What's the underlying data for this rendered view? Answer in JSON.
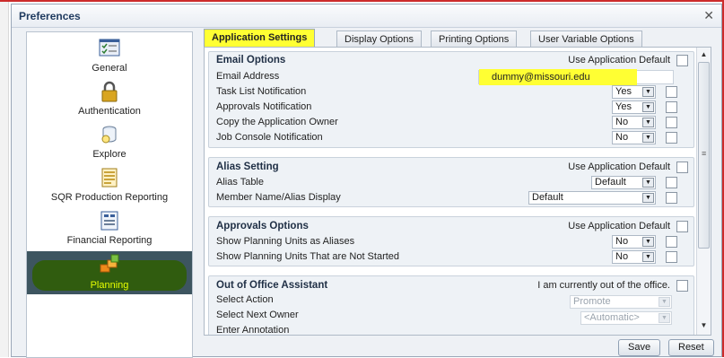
{
  "dialog": {
    "title": "Preferences",
    "close_icon": "close-icon"
  },
  "nav": [
    {
      "label": "General",
      "icon": "general-settings-icon"
    },
    {
      "label": "Authentication",
      "icon": "lock-icon"
    },
    {
      "label": "Explore",
      "icon": "explore-icon"
    },
    {
      "label": "SQR Production Reporting",
      "icon": "sqr-report-icon"
    },
    {
      "label": "Financial Reporting",
      "icon": "financial-report-icon"
    },
    {
      "label": "Planning",
      "icon": "planning-icon",
      "selected": true
    }
  ],
  "tabs": [
    {
      "label": "Application Settings",
      "active": true
    },
    {
      "label": "Display Options"
    },
    {
      "label": "Printing Options"
    },
    {
      "label": "User Variable Options"
    }
  ],
  "email": {
    "title": "Email Options",
    "default_label": "Use Application Default",
    "address_label": "Email Address",
    "address_value": "dummy@missouri.edu",
    "rows": [
      {
        "label": "Task List Notification",
        "value": "Yes"
      },
      {
        "label": "Approvals Notification",
        "value": "Yes"
      },
      {
        "label": "Copy the Application Owner",
        "value": "No"
      },
      {
        "label": "Job Console Notification",
        "value": "No"
      }
    ]
  },
  "alias": {
    "title": "Alias Setting",
    "default_label": "Use Application Default",
    "rows": [
      {
        "label": "Alias Table",
        "value": "Default"
      },
      {
        "label": "Member Name/Alias Display",
        "value": "Default"
      }
    ]
  },
  "approvals": {
    "title": "Approvals Options",
    "default_label": "Use Application Default",
    "rows": [
      {
        "label": "Show Planning Units as Aliases",
        "value": "No"
      },
      {
        "label": "Show Planning Units That are Not Started",
        "value": "No"
      }
    ]
  },
  "out_of_office": {
    "title": "Out of Office Assistant",
    "status_label": "I am currently out of the office.",
    "rows": [
      {
        "label": "Select Action",
        "value": "Promote"
      },
      {
        "label": "Select Next Owner",
        "value": "<Automatic>"
      },
      {
        "label": "Enter Annotation",
        "value": ""
      }
    ]
  },
  "buttons": {
    "save": "Save",
    "reset": "Reset"
  },
  "colors": {
    "highlight": "#ffff33",
    "selected_nav": "#3d5560",
    "planning_blob": "#2f5d0b"
  }
}
